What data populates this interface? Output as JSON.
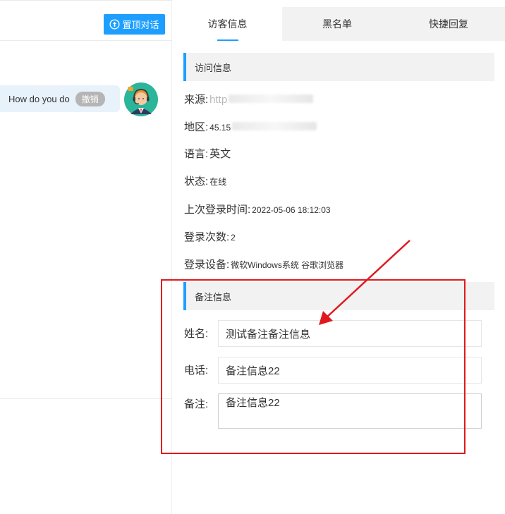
{
  "chat": {
    "pin_label": "置顶对话",
    "pin_icon": "arrow-up-circle-icon",
    "message_text": "How do you do",
    "revoke_label": "撤销",
    "avatar_icon": "agent-avatar-icon"
  },
  "tabs": [
    {
      "label": "访客信息",
      "active": true
    },
    {
      "label": "黑名单",
      "active": false
    },
    {
      "label": "快捷回复",
      "active": false
    }
  ],
  "visit": {
    "title": "访问信息",
    "source_label": "来源:",
    "source_value": "http",
    "region_label": "地区:",
    "region_value": "45.15",
    "language_label": "语言:",
    "language_value": "英文",
    "status_label": "状态:",
    "status_value": "在线",
    "last_login_label": "上次登录时间:",
    "last_login_value": "2022-05-06 18:12:03",
    "login_count_label": "登录次数:",
    "login_count_value": "2",
    "device_label": "登录设备:",
    "device_value": "微软Windows系统 谷歌浏览器"
  },
  "note": {
    "title": "备注信息",
    "name_label": "姓名:",
    "name_value": "测试备注备注信息",
    "phone_label": "电话:",
    "phone_value": "备注信息22",
    "remark_label": "备注:",
    "remark_value": "备注信息22"
  },
  "colors": {
    "accent": "#1e9fff",
    "annotation": "#e0191e",
    "tab_inactive": "#f2f2f2",
    "bubble": "#e8f2fb"
  }
}
